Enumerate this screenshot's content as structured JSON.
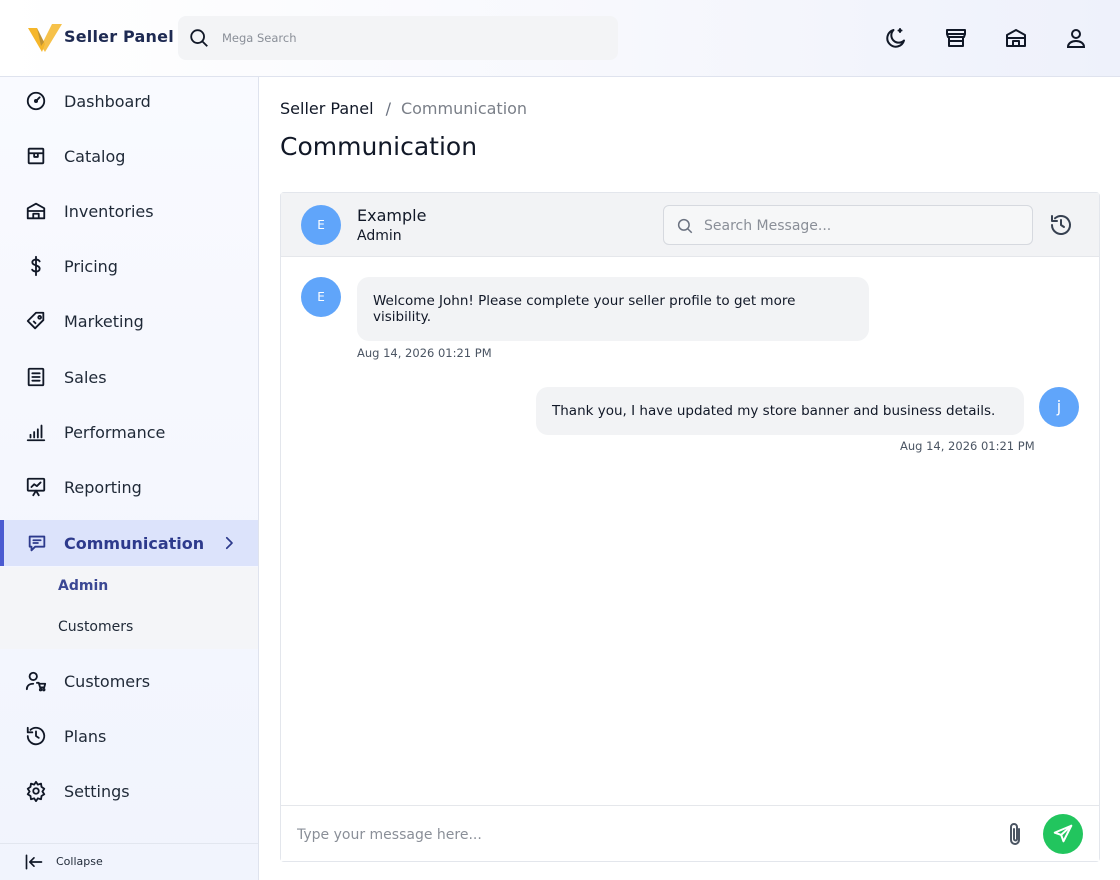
{
  "header": {
    "brand": "Seller Panel",
    "search_placeholder": "Mega Search",
    "icons": [
      "moon-icon",
      "store-icon",
      "warehouse-icon",
      "user-icon"
    ]
  },
  "sidebar": {
    "items": [
      {
        "label": "Dashboard",
        "icon": "dashboard-icon"
      },
      {
        "label": "Catalog",
        "icon": "catalog-icon"
      },
      {
        "label": "Inventories",
        "icon": "inventories-icon"
      },
      {
        "label": "Pricing",
        "icon": "dollar-icon"
      },
      {
        "label": "Marketing",
        "icon": "tag-icon"
      },
      {
        "label": "Sales",
        "icon": "sales-list-icon"
      },
      {
        "label": "Performance",
        "icon": "bar-chart-icon"
      },
      {
        "label": "Reporting",
        "icon": "presentation-icon"
      },
      {
        "label": "Communication",
        "icon": "chat-icon",
        "active": true
      },
      {
        "label": "Customers",
        "icon": "customers-cart-icon"
      },
      {
        "label": "Plans",
        "icon": "history-icon"
      },
      {
        "label": "Settings",
        "icon": "gear-icon"
      }
    ],
    "subitems": [
      {
        "label": "Admin",
        "active": true
      },
      {
        "label": "Customers"
      }
    ],
    "collapse_label": "Collapse"
  },
  "breadcrumb": {
    "root": "Seller Panel",
    "separator": "/",
    "current": "Communication"
  },
  "page_title": "Communication",
  "chat": {
    "contact": {
      "initial": "E",
      "name": "Example",
      "role": "Admin"
    },
    "search_placeholder": "Search Message...",
    "messages": [
      {
        "from": "admin",
        "initial": "E",
        "text": "Welcome John! Please complete your seller profile to get more visibility.",
        "time": "Aug 14, 2026 01:21 PM"
      },
      {
        "from": "me",
        "initial": "j",
        "text": "Thank you, I have updated my store banner and business details.",
        "time": "Aug 14, 2026 01:21 PM"
      }
    ],
    "composer_placeholder": "Type your message here..."
  },
  "colors": {
    "accent": "#4b5bd1",
    "avatar": "#60a5fa",
    "send": "#22c55e",
    "active_bg": "#dce3fb"
  }
}
